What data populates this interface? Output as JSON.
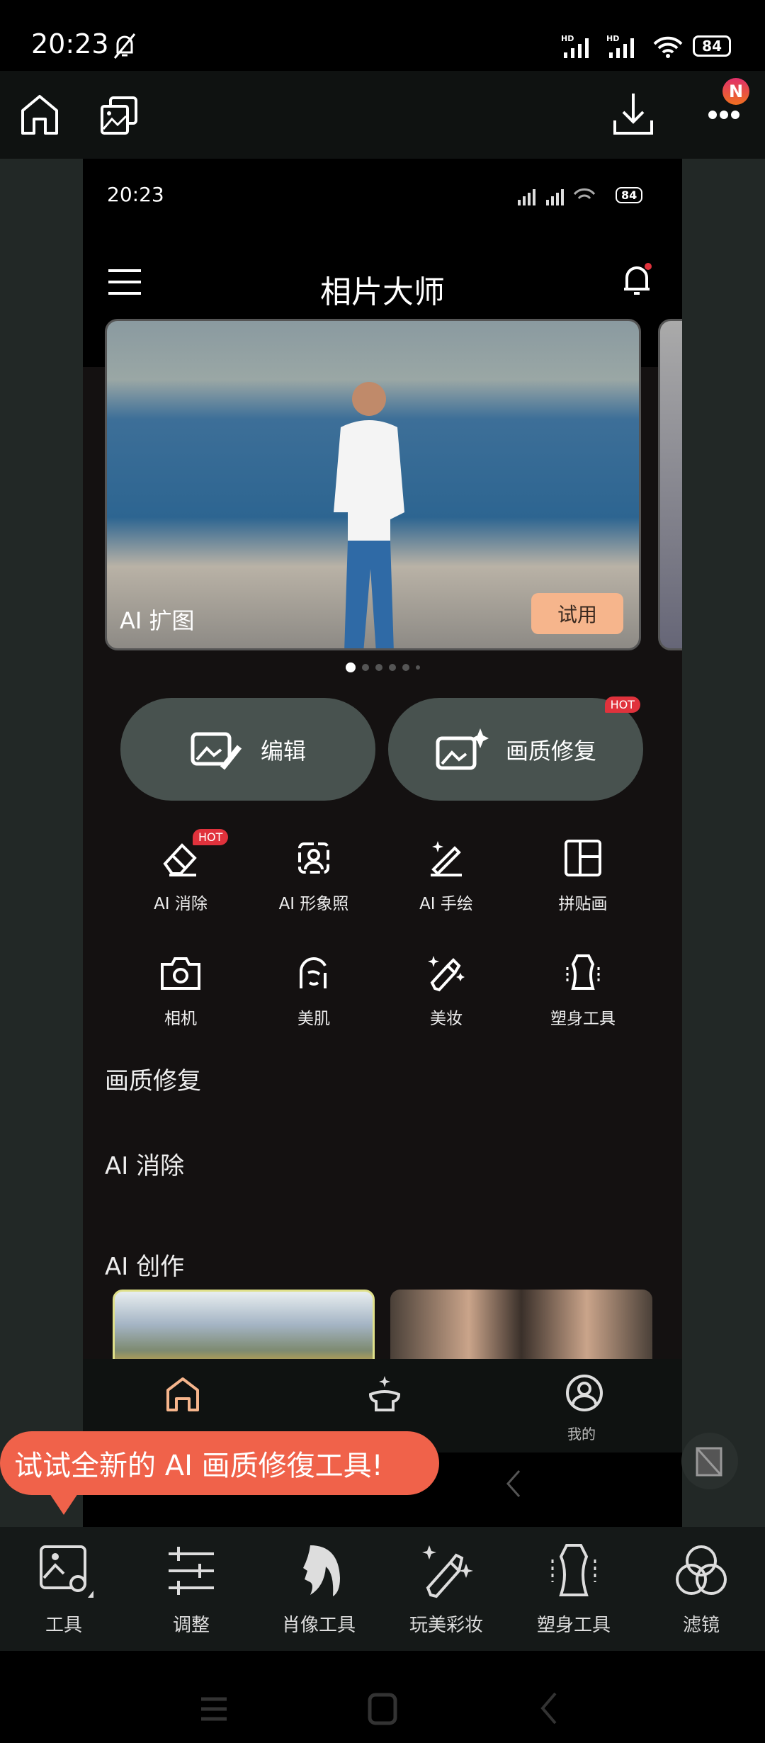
{
  "status": {
    "time": "20:23",
    "battery": "84"
  },
  "toolbar": {
    "icons": [
      "home-icon",
      "gallery-icon",
      "download-icon",
      "more-icon"
    ],
    "badge": "N"
  },
  "inner": {
    "status": {
      "time": "20:23",
      "battery": "84"
    },
    "title": "相片大师",
    "banner": {
      "label": "AI 扩图",
      "button": "试用",
      "page_index": 0,
      "page_count": 6
    },
    "big_buttons": [
      {
        "label": "编辑"
      },
      {
        "label": "画质修复",
        "badge": "HOT"
      }
    ],
    "tools": [
      {
        "label": "AI 消除",
        "badge": "HOT"
      },
      {
        "label": "AI 形象照"
      },
      {
        "label": "AI 手绘"
      },
      {
        "label": "拼贴画"
      },
      {
        "label": "相机"
      },
      {
        "label": "美肌"
      },
      {
        "label": "美妆"
      },
      {
        "label": "塑身工具"
      }
    ],
    "sections": [
      "画质修复",
      "AI 消除",
      "AI 创作"
    ],
    "bottom_nav": [
      {
        "label": ""
      },
      {
        "label": ""
      },
      {
        "label": "我的"
      }
    ],
    "accent": "#f6b58c"
  },
  "tooltip": "试试全新的 AI 画质修復工具!",
  "bottom_tools": [
    {
      "label": "工具"
    },
    {
      "label": "调整"
    },
    {
      "label": "肖像工具"
    },
    {
      "label": "玩美彩妆"
    },
    {
      "label": "塑身工具"
    },
    {
      "label": "滤镜"
    }
  ],
  "colors": {
    "tooltip": "#f0624a",
    "hot": "#e0323c"
  }
}
